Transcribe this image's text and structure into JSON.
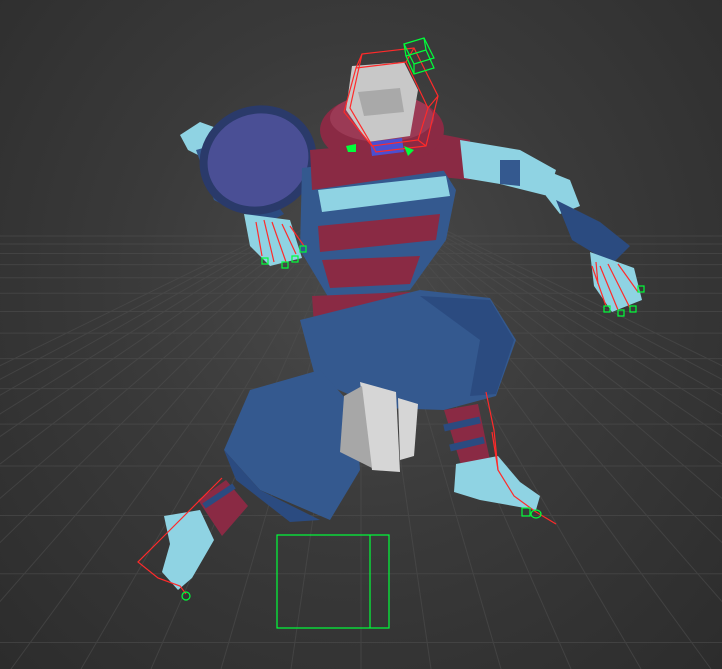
{
  "viewport": {
    "background_color": "#393939",
    "grid_color": "#505050"
  },
  "character": {
    "colors": {
      "skin": "#8fd3e3",
      "robe_dark": "#2b4b80",
      "robe_mid": "#34598f",
      "stripe_red": "#8a2a44",
      "stripe_red_light": "#9b3a55",
      "hood": "#4a4f95",
      "head": "#c8c8c8",
      "pouch": "#d6d6d6"
    }
  },
  "rig": {
    "bone_color": "#ff2a2a",
    "control_color": "#00ff3a",
    "helpers": [
      {
        "id": "head-bone-box",
        "color": "#ff2a2a"
      },
      {
        "id": "head-control",
        "color": "#00ff3a"
      },
      {
        "id": "root-control",
        "color": "#00ff3a"
      }
    ]
  }
}
